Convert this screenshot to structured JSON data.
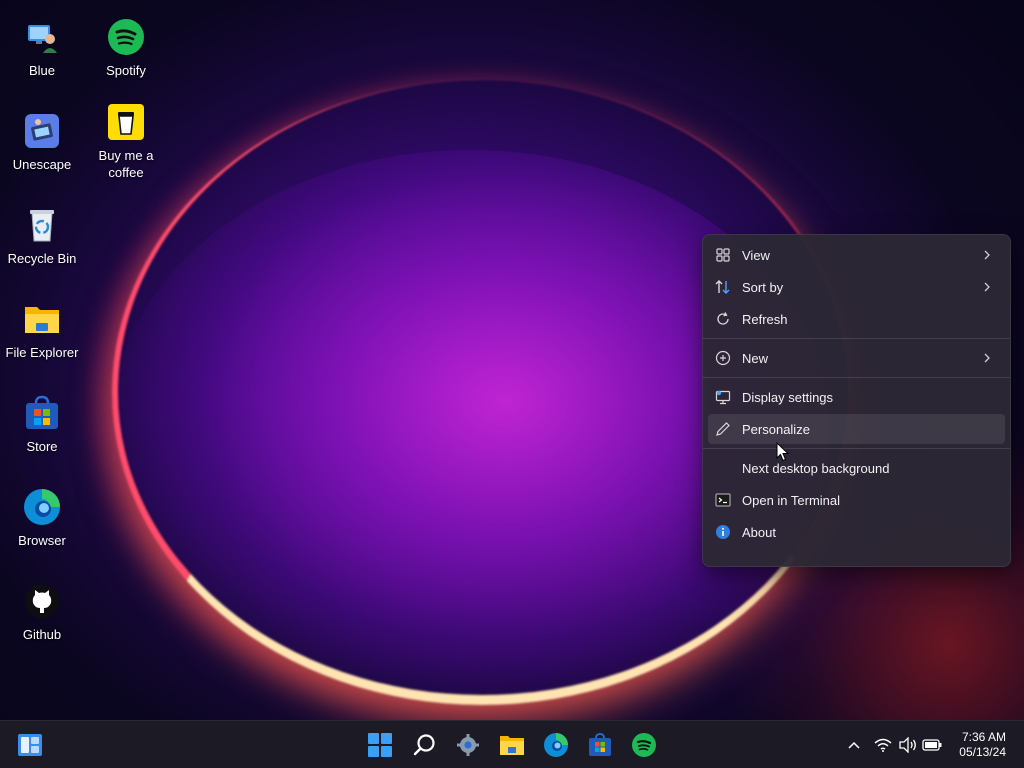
{
  "desktop": {
    "icons": [
      {
        "label": "Blue",
        "icon": "user-computer-icon"
      },
      {
        "label": "Spotify",
        "icon": "spotify-icon"
      },
      {
        "label": "Unescape",
        "icon": "unescape-app-icon"
      },
      {
        "label": "Buy me a coffee",
        "icon": "coffee-cup-icon"
      },
      {
        "label": "Recycle Bin",
        "icon": "recycle-bin-icon"
      },
      {
        "label": "File Explorer",
        "icon": "folder-icon"
      },
      {
        "label": "Store",
        "icon": "store-icon"
      },
      {
        "label": "Browser",
        "icon": "edge-browser-icon"
      },
      {
        "label": "Github",
        "icon": "github-icon"
      }
    ]
  },
  "context_menu": {
    "items": [
      {
        "label": "View",
        "icon": "grid-icon",
        "submenu": true
      },
      {
        "label": "Sort by",
        "icon": "sort-icon",
        "submenu": true
      },
      {
        "label": "Refresh",
        "icon": "refresh-icon",
        "submenu": false
      },
      {
        "label": "New",
        "icon": "plus-circle-icon",
        "submenu": true
      },
      {
        "label": "Display settings",
        "icon": "display-icon",
        "submenu": false
      },
      {
        "label": "Personalize",
        "icon": "pencil-icon",
        "submenu": false,
        "hovered": true
      },
      {
        "label": "Next desktop background",
        "icon": "",
        "submenu": false
      },
      {
        "label": "Open in Terminal",
        "icon": "terminal-icon",
        "submenu": false
      },
      {
        "label": "About",
        "icon": "info-icon",
        "submenu": false
      }
    ]
  },
  "taskbar": {
    "left": [
      "widgets-icon"
    ],
    "center": [
      "start-windows-icon",
      "search-icon",
      "settings-gear-icon",
      "file-explorer-icon",
      "edge-browser-icon",
      "store-icon",
      "spotify-icon"
    ],
    "tray": [
      "chevron-up-icon",
      "wifi-icon",
      "volume-icon",
      "battery-icon"
    ],
    "time": "7:36 AM",
    "date": "05/13/24"
  },
  "colors": {
    "accent": "#0078d4",
    "spotify": "#1db954",
    "menu_bg": "#2c2834",
    "taskbar_bg": "#1c1a24"
  }
}
